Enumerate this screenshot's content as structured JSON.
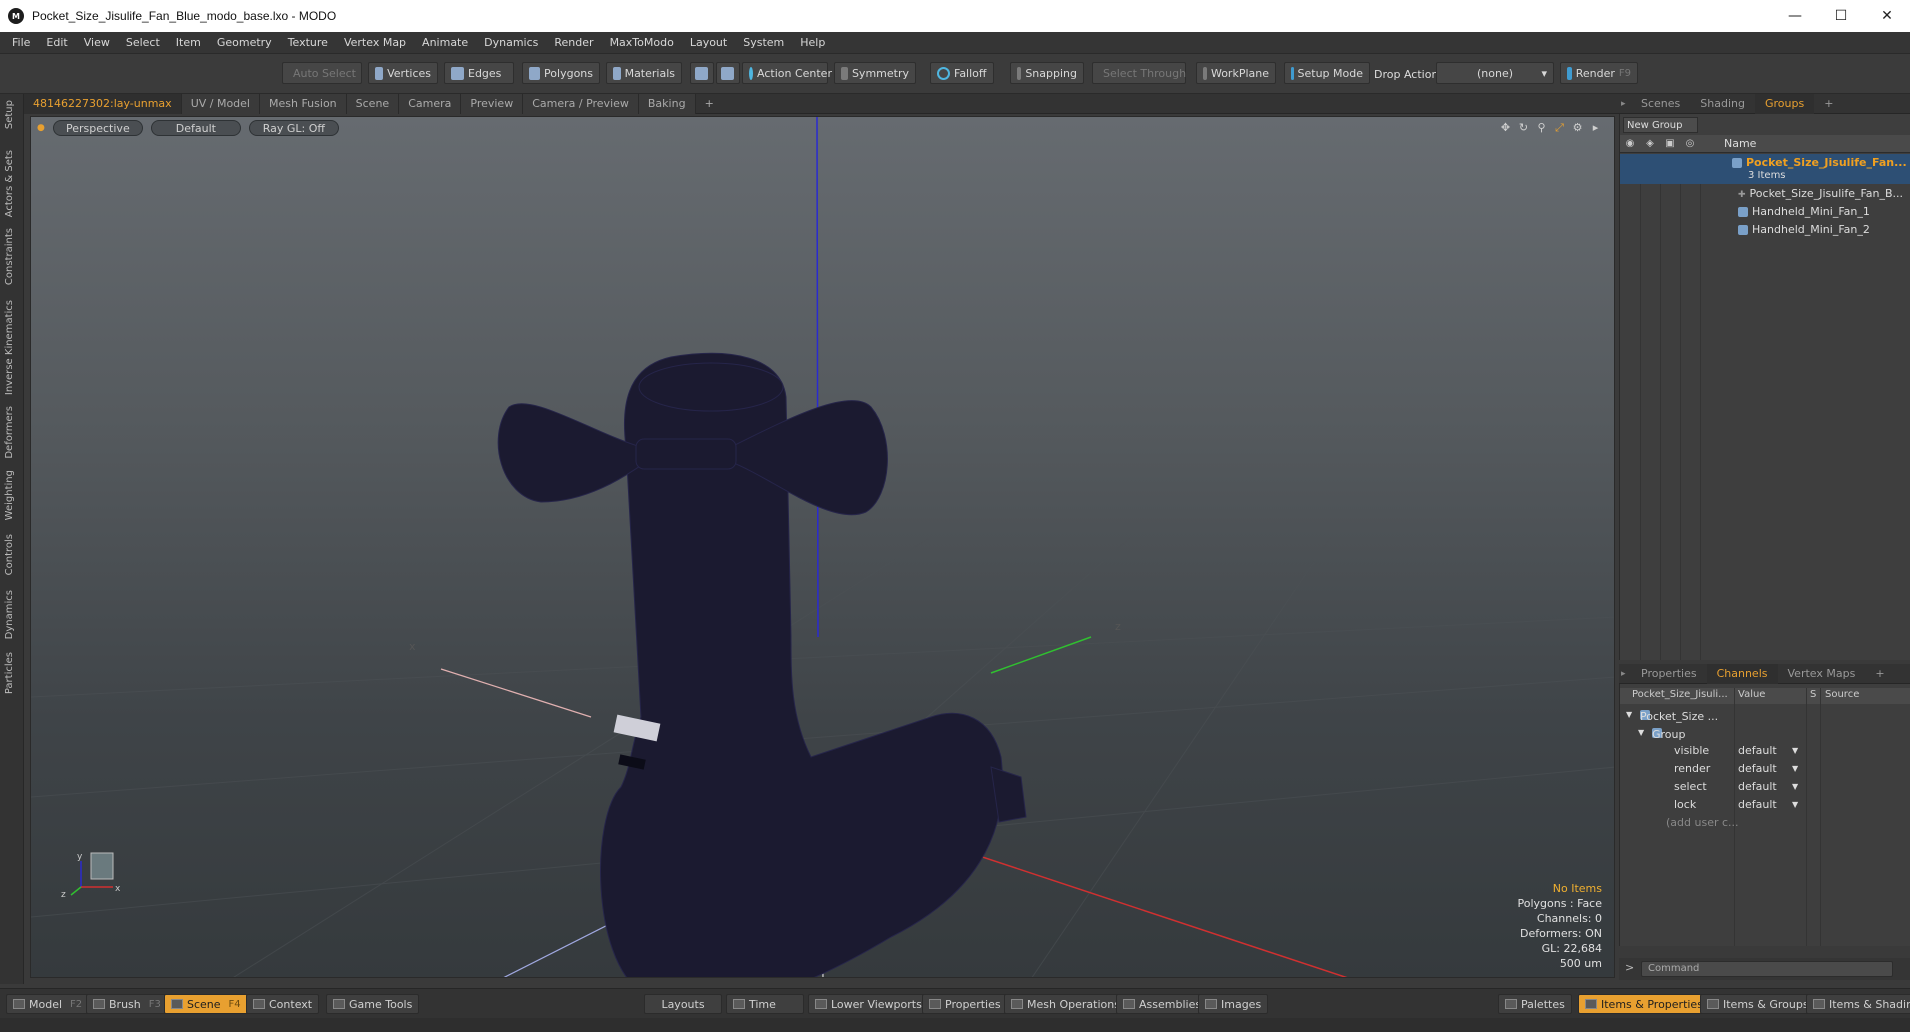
{
  "window": {
    "title": "Pocket_Size_Jisulife_Fan_Blue_modo_base.lxo - MODO"
  },
  "menu": [
    "File",
    "Edit",
    "View",
    "Select",
    "Item",
    "Geometry",
    "Texture",
    "Vertex Map",
    "Animate",
    "Dynamics",
    "Render",
    "MaxToModo",
    "Layout",
    "System",
    "Help"
  ],
  "toolbar": {
    "auto_select": "Auto Select",
    "vertices": "Vertices",
    "edges": "Edges",
    "polygons": "Polygons",
    "materials": "Materials",
    "action_center": "Action Center",
    "symmetry": "Symmetry",
    "falloff": "Falloff",
    "snapping": "Snapping",
    "select_through": "Select Through",
    "workplane": "WorkPlane",
    "setup_mode": "Setup Mode",
    "drop_action": "Drop Action",
    "drop_value": "(none)",
    "render": "Render",
    "render_key": "F9"
  },
  "left_tabs": [
    "Setup",
    "Actors & Sets",
    "Constraints",
    "Inverse Kinematics",
    "Deformers",
    "Weighting",
    "Controls",
    "Dynamics",
    "Particles"
  ],
  "viewport_tabs": [
    "48146227302:lay-unmax",
    "UV / Model",
    "Mesh Fusion",
    "Scene",
    "Camera",
    "Preview",
    "Camera / Preview",
    "Baking",
    "+"
  ],
  "viewport": {
    "view": "Perspective",
    "shading": "Default",
    "raygl": "Ray GL: Off",
    "info": {
      "items": "No Items",
      "polygons": "Polygons : Face",
      "channels": "Channels: 0",
      "deformers": "Deformers: ON",
      "gl": "GL: 22,684",
      "scale": "500 um"
    },
    "axis_labels": {
      "x": "x",
      "y": "y",
      "z": "z"
    }
  },
  "right_tabs": [
    "Scenes",
    "Shading",
    "Groups",
    "+"
  ],
  "groups": {
    "new_group": "New Group",
    "name_header": "Name",
    "root": {
      "name": "Pocket_Size_Jisulife_Fan...",
      "count": "3 Items"
    },
    "children": [
      "Pocket_Size_Jisulife_Fan_B...",
      "Handheld_Mini_Fan_1",
      "Handheld_Mini_Fan_2"
    ]
  },
  "props_tabs": [
    "Properties",
    "Channels",
    "Vertex Maps",
    "+"
  ],
  "channels": {
    "headers": {
      "name": "Pocket_Size_Jisuli...",
      "value": "Value",
      "s": "S",
      "source": "Source"
    },
    "item": "Pocket_Size ...",
    "group": "Group",
    "rows": [
      {
        "name": "visible",
        "value": "default"
      },
      {
        "name": "render",
        "value": "default"
      },
      {
        "name": "select",
        "value": "default"
      },
      {
        "name": "lock",
        "value": "default"
      }
    ],
    "add_user": "(add user c..."
  },
  "command": {
    "placeholder": "Command"
  },
  "bottom": {
    "model": "Model",
    "model_key": "F2",
    "brush": "Brush",
    "brush_key": "F3",
    "scene": "Scene",
    "scene_key": "F4",
    "context": "Context",
    "game_tools": "Game Tools",
    "layouts": "Layouts",
    "time": "Time",
    "lower_viewports": "Lower Viewports",
    "properties": "Properties",
    "mesh_operations": "Mesh Operations",
    "assemblies": "Assemblies",
    "images": "Images",
    "palettes": "Palettes",
    "items_properties": "Items & Properties",
    "items_groups": "Items & Groups",
    "items_shading": "Items & Shading"
  },
  "colors": {
    "accent": "#e8a030",
    "model": "#1b1a30",
    "axis_x": "#d03030",
    "axis_y": "#2a2ad0",
    "axis_z": "#30c030"
  }
}
